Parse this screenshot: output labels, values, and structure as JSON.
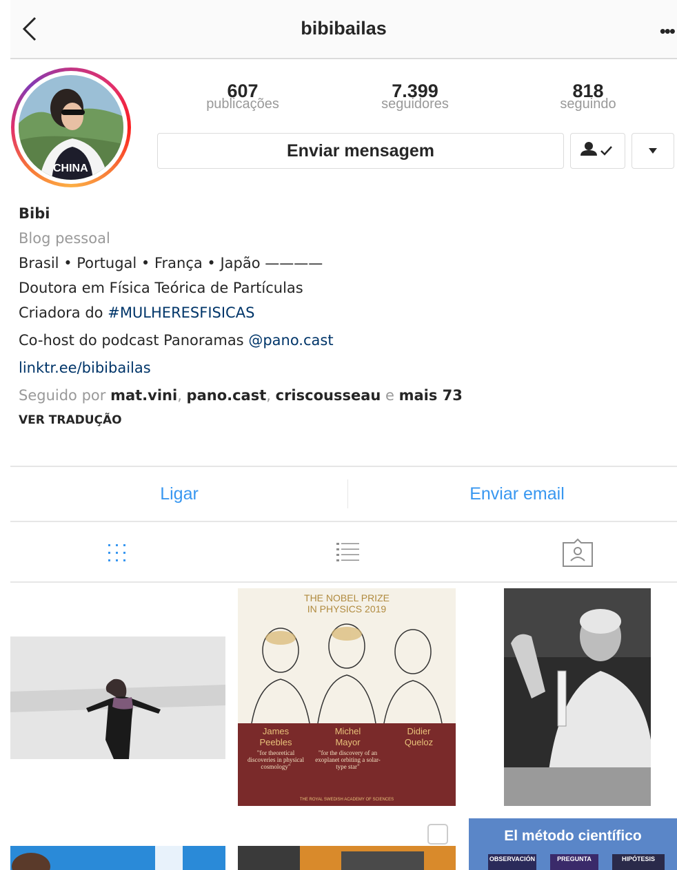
{
  "header": {
    "username": "bibibailas"
  },
  "stats": [
    {
      "value": "607",
      "label": "publicações"
    },
    {
      "value": "7.399",
      "label": "seguidores"
    },
    {
      "value": "818",
      "label": "seguindo"
    }
  ],
  "actions": {
    "message_label": "Enviar mensagem"
  },
  "bio": {
    "name": "Bibi",
    "category": "Blog pessoal",
    "line1": "Brasil • Portugal • França • Japão ————",
    "line2": "Doutora em Física Teórica de Partículas",
    "line3_prefix": "Criadora do ",
    "line3_hashtag": "#MULHERESFISICAS",
    "line4_prefix": "Co-host do podcast Panoramas ",
    "line4_mention": "@pano.cast",
    "website": "linktr.ee/bibibailas",
    "followed_by_prefix": "Seguido por ",
    "followed_by_users": [
      "mat.vini",
      "pano.cast",
      "criscousseau"
    ],
    "followed_by_sep": ", ",
    "followed_by_and": " e ",
    "followed_by_more": "mais 73",
    "translate_label": "VER TRADUÇÃO"
  },
  "contact": {
    "call_label": "Ligar",
    "email_label": "Enviar email"
  },
  "grid": {
    "nobel": {
      "title_line1": "THE NOBEL PRIZE",
      "title_line2": "IN PHYSICS 2019",
      "laureates": [
        {
          "first": "James",
          "last": "Peebles",
          "quote": "\"for theoretical discoveries in physical cosmology\""
        },
        {
          "first": "Michel",
          "last": "Mayor",
          "quote": "\"for the discovery of an exoplanet orbiting a solar-type star\""
        },
        {
          "first": "Didier",
          "last": "Queloz",
          "quote": ""
        }
      ],
      "footer": "THE ROYAL SWEDISH ACADEMY OF SCIENCES"
    },
    "metodo": {
      "title": "El método científico",
      "steps": [
        "OBSERVACIÓN",
        "PREGUNTA",
        "HIPÓTESIS"
      ]
    }
  },
  "colors": {
    "link": "#003569",
    "action_blue": "#3897f0",
    "muted": "#999999",
    "nobel_maroon": "#7a2a2a",
    "nobel_gold": "#b08a3e"
  }
}
